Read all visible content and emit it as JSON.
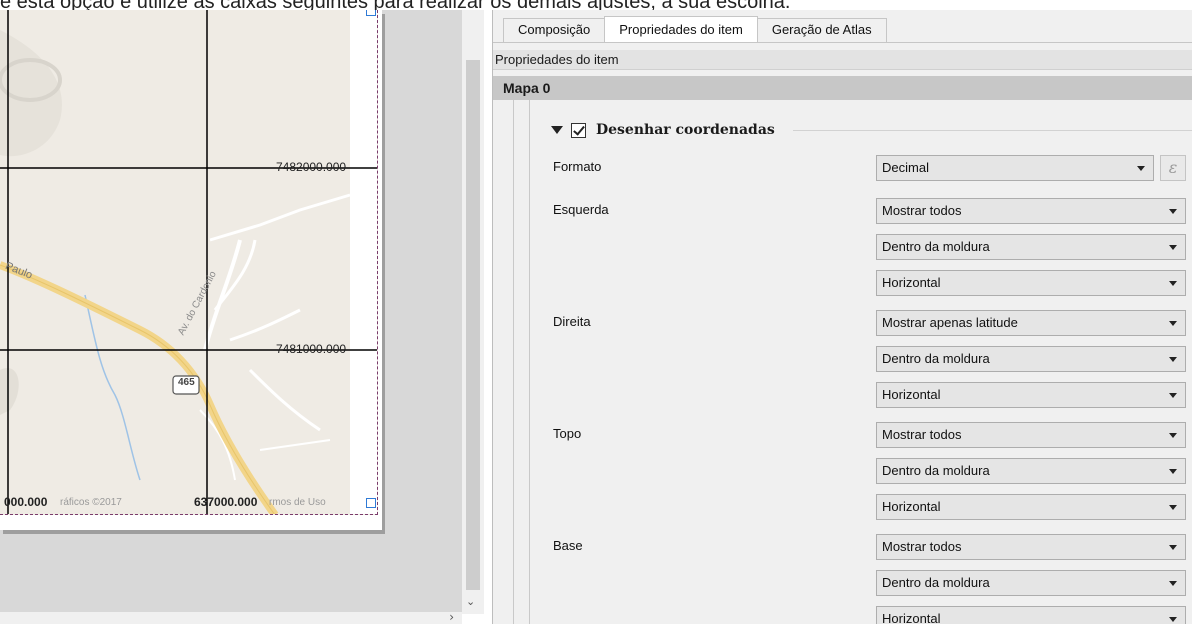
{
  "top_caption": "e esta opção e utilize as caixas seguintes para realizar os demais ajustes, a sua escolha.",
  "map": {
    "grid_labels": {
      "north_upper": "7482000.000",
      "north_lower": "7481000.000",
      "bottom_left": "000.000",
      "bottom_right": "637000.000"
    },
    "road_label_sp": "Paulo",
    "road_label_av": "Av. do Cardonio",
    "route_shield": "465",
    "attribution_left": "ráficos ©2017",
    "attribution_right": "rmos de Uso"
  },
  "tabs": [
    {
      "label": "Composição",
      "active": false
    },
    {
      "label": "Propriedades do item",
      "active": true
    },
    {
      "label": "Geração de Atlas",
      "active": false
    }
  ],
  "panel_title": "Propriedades do item",
  "item_name": "Mapa 0",
  "group": {
    "label": "Desenhar coordenadas",
    "checked": true
  },
  "rows": {
    "formato": {
      "label": "Formato",
      "value": "Decimal"
    },
    "esquerda": {
      "label": "Esquerda",
      "values": [
        "Mostrar todos",
        "Dentro da moldura",
        "Horizontal"
      ]
    },
    "direita": {
      "label": "Direita",
      "values": [
        "Mostrar apenas latitude",
        "Dentro da moldura",
        "Horizontal"
      ]
    },
    "topo": {
      "label": "Topo",
      "values": [
        "Mostrar todos",
        "Dentro da moldura",
        "Horizontal"
      ]
    },
    "base": {
      "label": "Base",
      "values": [
        "Mostrar todos",
        "Dentro da moldura",
        "Horizontal"
      ]
    }
  },
  "expression_button": "ε",
  "colors": {
    "grid_line": "#000000",
    "frame_border": "#7a3b6b",
    "road": "#f2d58a",
    "water": "#9fc3e6",
    "map_bg": "#efebe4"
  }
}
